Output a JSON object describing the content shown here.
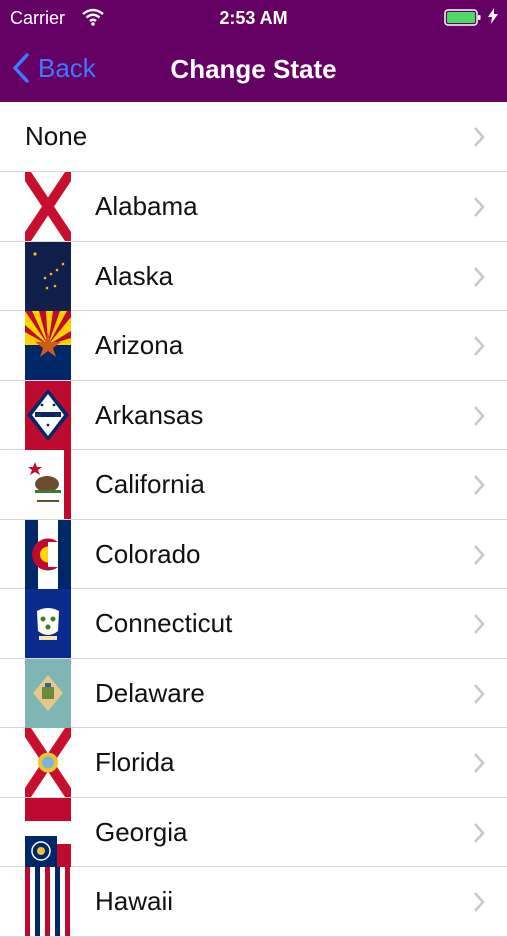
{
  "status_bar": {
    "carrier": "Carrier",
    "time": "2:53 AM"
  },
  "nav": {
    "back_label": "Back",
    "title": "Change State"
  },
  "rows": [
    {
      "label": "None",
      "flag": null
    },
    {
      "label": "Alabama",
      "flag": "alabama-flag"
    },
    {
      "label": "Alaska",
      "flag": "alaska-flag"
    },
    {
      "label": "Arizona",
      "flag": "arizona-flag"
    },
    {
      "label": "Arkansas",
      "flag": "arkansas-flag"
    },
    {
      "label": "California",
      "flag": "california-flag"
    },
    {
      "label": "Colorado",
      "flag": "colorado-flag"
    },
    {
      "label": "Connecticut",
      "flag": "connecticut-flag"
    },
    {
      "label": "Delaware",
      "flag": "delaware-flag"
    },
    {
      "label": "Florida",
      "flag": "florida-flag"
    },
    {
      "label": "Georgia",
      "flag": "georgia-flag"
    },
    {
      "label": "Hawaii",
      "flag": "hawaii-flag"
    }
  ],
  "colors": {
    "nav_bg": "#650065",
    "accent": "#3b7bff",
    "battery": "#4cd964"
  }
}
